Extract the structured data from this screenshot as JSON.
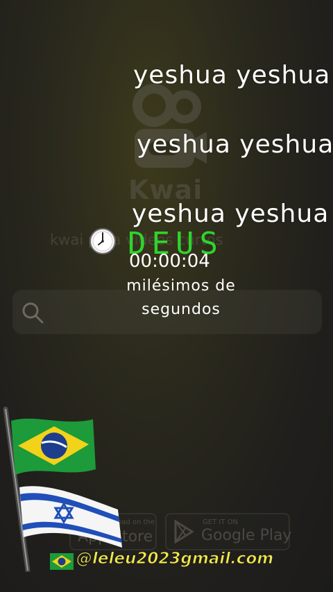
{
  "background_app": {
    "logo_text": "Kwai",
    "tagline": "kwai para vídeos curtos",
    "search_placeholder": "",
    "store_badges": {
      "app_store": {
        "small": "Download on the",
        "big": "App Store"
      },
      "google_play": {
        "small": "GET IT ON",
        "big": "Google Play"
      }
    }
  },
  "overlay": {
    "yeshua_lines": [
      "yeshua yeshua",
      "yeshua yeshua",
      "yeshua yeshua"
    ],
    "deus_text": "DEUS",
    "timer_value": "00:00:04",
    "timer_label": "milésimos de segundos",
    "email": "@leleu2023gmail.com"
  },
  "colors": {
    "deus": "#2ee62e",
    "email": "#f1e84a",
    "brazil_green": "#1d9a3a",
    "brazil_yellow": "#f2d31a",
    "brazil_blue": "#1c3e8c",
    "israel_blue": "#1f4fb8"
  },
  "icons": [
    "kwai-camera-icon",
    "search-icon",
    "clock-icon",
    "brazil-flag-icon",
    "israel-flag-icon",
    "apple-icon",
    "google-play-icon"
  ]
}
